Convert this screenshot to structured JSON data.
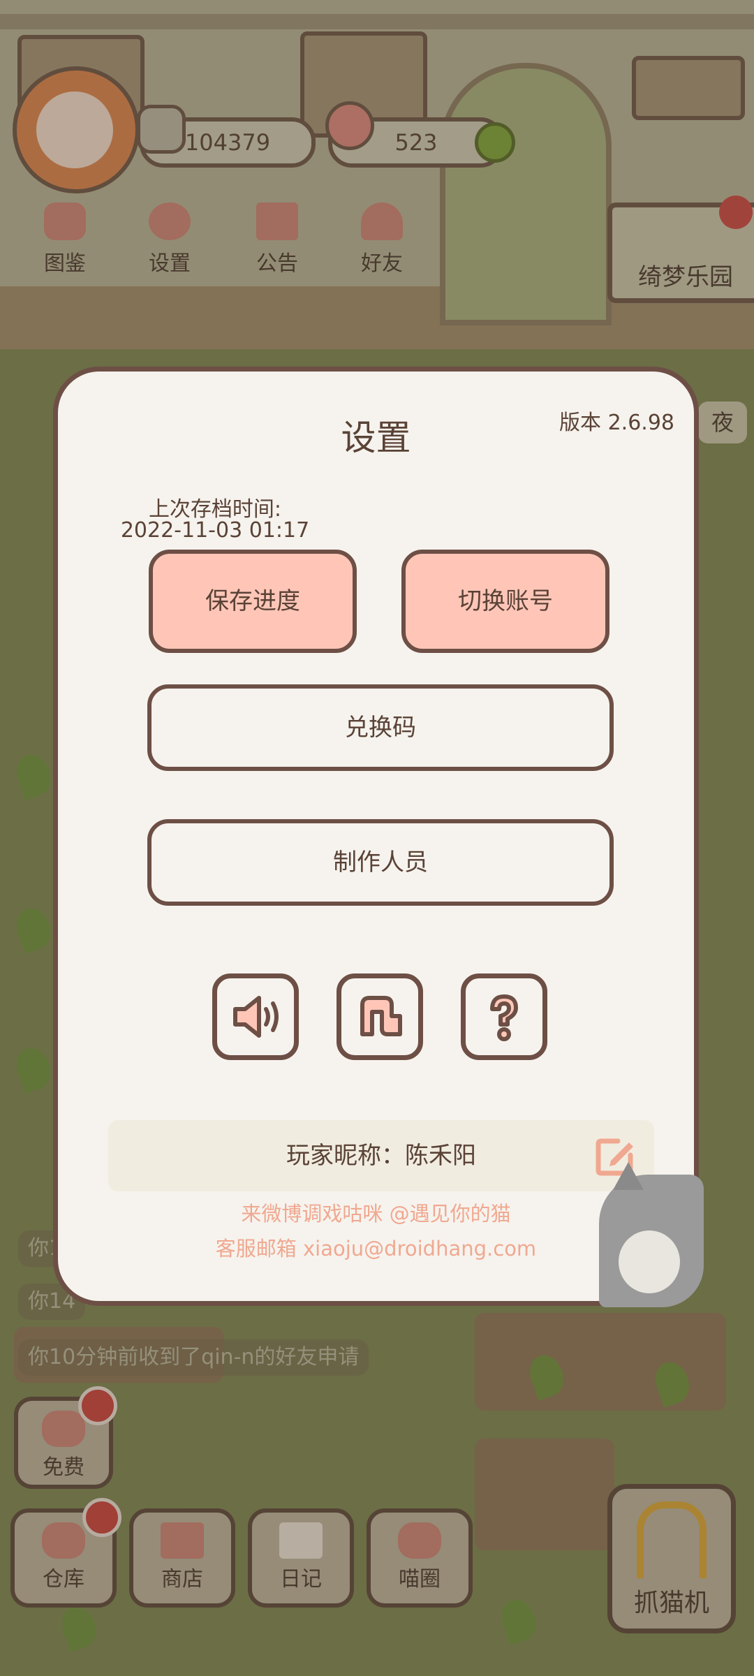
{
  "hud": {
    "coins": "104379",
    "hearts": "523"
  },
  "top_menu": {
    "illustrated_guide": "图鉴",
    "settings": "设置",
    "announcement": "公告",
    "friends": "好友"
  },
  "park_sign": "绮梦乐园",
  "night_label": "夜",
  "feed": [
    "你1",
    "你14",
    "你10分钟前收到了qin-n的好友申请"
  ],
  "bottom_nav": {
    "free": "免费",
    "warehouse": "仓库",
    "shop": "商店",
    "diary": "日记",
    "cat_circle": "喵圈",
    "claw_machine": "抓猫机"
  },
  "dialog": {
    "title": "设置",
    "version": "版本 2.6.98",
    "last_save_label": "上次存档时间:",
    "last_save_time": "2022-11-03 01:17",
    "save_progress": "保存进度",
    "switch_account": "切换账号",
    "redeem_code": "兑换码",
    "credits": "制作人员",
    "icons": [
      "sound-icon",
      "music-icon",
      "help-icon"
    ],
    "nickname_label": "玩家昵称：陈禾阳",
    "footer_weibo": "来微博调戏咕咪 @遇见你的猫",
    "footer_email": "客服邮箱 xiaoju@droidhang.com"
  },
  "colors": {
    "accent_pink": "#ffc6b8",
    "border_brown": "#6d4f45",
    "dialog_bg": "#f6f3ee",
    "footer_text": "#f0a890"
  }
}
